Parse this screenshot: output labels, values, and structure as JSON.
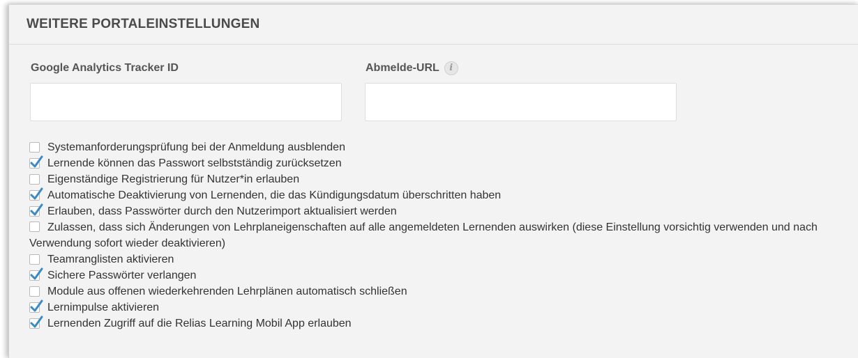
{
  "panel": {
    "title": "WEITERE PORTALEINSTELLUNGEN"
  },
  "fields": {
    "tracker_label": "Google Analytics Tracker ID",
    "tracker_value": "",
    "logout_label": "Abmelde-URL",
    "logout_value": "",
    "info_icon_glyph": "i"
  },
  "colors": {
    "check": "#3a8ac4",
    "panel_bg": "#f3f3f3"
  },
  "options": [
    {
      "label": "Systemanforderungsprüfung bei der Anmeldung ausblenden",
      "checked": false
    },
    {
      "label": "Lernende können das Passwort selbstständig zurücksetzen",
      "checked": true
    },
    {
      "label": "Eigenständige Registrierung für Nutzer*in erlauben",
      "checked": false
    },
    {
      "label": "Automatische Deaktivierung von Lernenden, die das Kündigungsdatum überschritten haben",
      "checked": true
    },
    {
      "label": "Erlauben, dass Passwörter durch den Nutzerimport aktualisiert werden",
      "checked": true
    },
    {
      "label": "Zulassen, dass sich Änderungen von Lehrplaneigenschaften auf alle angemeldeten Lernenden auswirken (diese Einstellung vorsichtig verwenden und nach Verwendung sofort wieder deaktivieren)",
      "checked": false
    },
    {
      "label": "Teamranglisten aktivieren",
      "checked": false
    },
    {
      "label": "Sichere Passwörter verlangen",
      "checked": true
    },
    {
      "label": "Module aus offenen wiederkehrenden Lehrplänen automatisch schließen",
      "checked": false
    },
    {
      "label": "Lernimpulse aktivieren",
      "checked": true
    },
    {
      "label": "Lernenden Zugriff auf die Relias Learning Mobil App erlauben",
      "checked": true
    }
  ]
}
